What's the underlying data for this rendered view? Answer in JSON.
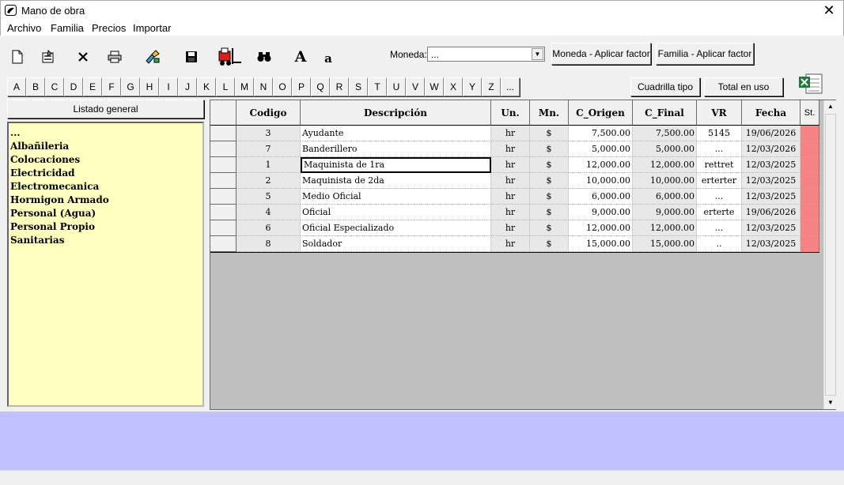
{
  "window": {
    "title": "Mano de obra"
  },
  "menu": [
    "Archivo",
    "Familia",
    "Precios",
    "Importar"
  ],
  "toolbar": {
    "icons": [
      "new-icon",
      "properties-icon",
      "delete-icon",
      "print-icon",
      "tools-icon",
      "save-icon",
      "forklift-icon",
      "binoculars-icon",
      "font-large-icon",
      "font-small-icon"
    ],
    "font_large": "A",
    "font_small": "a",
    "moneda_label": "Moneda:",
    "moneda_value": "...",
    "moneda_factor_btn": "Moneda - Aplicar factor",
    "familia_factor_btn": "Familia - Aplicar factor"
  },
  "letters": [
    "A",
    "B",
    "C",
    "D",
    "E",
    "F",
    "G",
    "H",
    "I",
    "J",
    "K",
    "L",
    "M",
    "N",
    "O",
    "P",
    "Q",
    "R",
    "S",
    "T",
    "U",
    "V",
    "W",
    "X",
    "Y",
    "Z",
    "..."
  ],
  "buttons": {
    "cuadrilla": "Cuadrilla tipo",
    "total": "Total en uso"
  },
  "left_panel": {
    "header": "Listado general",
    "items": [
      "...",
      "Albañileria",
      "Colocaciones",
      "Electricidad",
      "Electromecanica",
      "Hormigon Armado",
      "Personal (Agua)",
      "Personal Propio",
      "Sanitarias"
    ]
  },
  "grid": {
    "columns": [
      "Codigo",
      "Descripción",
      "Un.",
      "Mn.",
      "C_Origen",
      "C_Final",
      "VR",
      "Fecha",
      "St."
    ],
    "rows": [
      [
        "3",
        "Ayudante",
        "hr",
        "$",
        "7,500.00",
        "7,500.00",
        "5145",
        "19/06/2026"
      ],
      [
        "7",
        "Banderillero",
        "hr",
        "$",
        "5,000.00",
        "5,000.00",
        "...",
        "12/03/2026"
      ],
      [
        "1",
        "Maquinista de 1ra",
        "hr",
        "$",
        "12,000.00",
        "12,000.00",
        "rettret",
        "12/03/2025"
      ],
      [
        "2",
        "Maquinista de 2da",
        "hr",
        "$",
        "10,000.00",
        "10,000.00",
        "erterter",
        "12/03/2025"
      ],
      [
        "5",
        "Medio Oficial",
        "hr",
        "$",
        "6,000.00",
        "6,000.00",
        "...",
        "12/03/2025"
      ],
      [
        "4",
        "Oficial",
        "hr",
        "$",
        "9,000.00",
        "9,000.00",
        "erterte",
        "19/06/2026"
      ],
      [
        "6",
        "Oficial Especializado",
        "hr",
        "$",
        "12,000.00",
        "12,000.00",
        "...",
        "12/03/2025"
      ],
      [
        "8",
        "Soldador",
        "hr",
        "$",
        "15,000.00",
        "15,000.00",
        "..",
        "12/03/2025"
      ]
    ]
  },
  "colors": {
    "family_bg": "#ffffc0",
    "status_cell": "#f48484",
    "bottom_panel": "#c0c0ff",
    "grid_bg": "#c0c0c0"
  }
}
